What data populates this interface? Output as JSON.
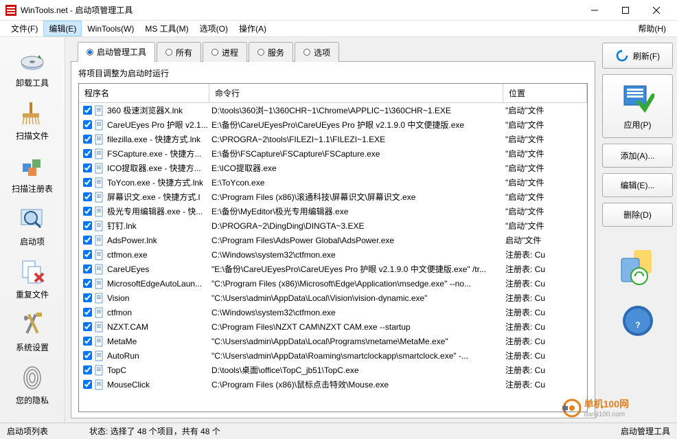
{
  "window": {
    "title": "WinTools.net - 启动项管理工具"
  },
  "menu": {
    "file": "文件(F)",
    "edit": "编辑(E)",
    "wintools": "WinTools(W)",
    "mstools": "MS 工具(M)",
    "options": "选项(O)",
    "actions": "操作(A)",
    "help": "帮助(H)"
  },
  "sidebar": [
    {
      "label": "卸载工具",
      "svg": "disk"
    },
    {
      "label": "扫描文件",
      "svg": "broom"
    },
    {
      "label": "扫描注册表",
      "svg": "blocks"
    },
    {
      "label": "启动项",
      "svg": "magnify"
    },
    {
      "label": "重复文件",
      "svg": "dup"
    },
    {
      "label": "系统设置",
      "svg": "tools"
    },
    {
      "label": "您的隐私",
      "svg": "finger"
    }
  ],
  "tabs": [
    {
      "label": "启动管理工具",
      "active": true
    },
    {
      "label": "所有"
    },
    {
      "label": "进程"
    },
    {
      "label": "服务"
    },
    {
      "label": "选项"
    }
  ],
  "subtitle": "将项目调整为启动时运行",
  "columns": {
    "name": "程序名",
    "cmd": "命令行",
    "loc": "位置"
  },
  "rows": [
    {
      "checked": true,
      "name": "360 极速浏览器X.lnk",
      "cmd": "D:\\tools\\360浏~1\\360CHR~1\\Chrome\\APPLIC~1\\360CHR~1.EXE",
      "loc": "\"启动\"文件"
    },
    {
      "checked": true,
      "name": "CareUEyes Pro 护眼 v2.1...",
      "cmd": "E:\\备份\\CareUEyesPro\\CareUEyes Pro 护眼 v2.1.9.0 中文便捷版.exe",
      "loc": "\"启动\"文件"
    },
    {
      "checked": true,
      "name": "filezilla.exe - 快捷方式.lnk",
      "cmd": "C:\\PROGRA~2\\tools\\FILEZI~1.1\\FILEZI~1.EXE",
      "loc": "\"启动\"文件"
    },
    {
      "checked": true,
      "name": "FSCapture.exe - 快捷方...",
      "cmd": "E:\\备份\\FSCapture\\FSCapture\\FSCapture.exe",
      "loc": "\"启动\"文件"
    },
    {
      "checked": true,
      "name": "ICO提取器.exe - 快捷方...",
      "cmd": "E:\\ICO提取器.exe",
      "loc": "\"启动\"文件"
    },
    {
      "checked": true,
      "name": "ToYcon.exe - 快捷方式.lnk",
      "cmd": "E:\\ToYcon.exe",
      "loc": "\"启动\"文件"
    },
    {
      "checked": true,
      "name": "屏幕识文.exe - 快捷方式.l",
      "cmd": "C:\\Program Files (x86)\\滚通科技\\屏幕识文\\屏幕识文.exe",
      "loc": "\"启动\"文件"
    },
    {
      "checked": true,
      "name": "极光专用编辑器.exe - 快...",
      "cmd": "E:\\备份\\MyEditor\\极光专用编辑器.exe",
      "loc": "\"启动\"文件"
    },
    {
      "checked": true,
      "name": "钉钉.lnk",
      "cmd": "D:\\PROGRA~2\\DingDing\\DINGTA~3.EXE",
      "loc": "\"启动\"文件"
    },
    {
      "checked": true,
      "name": "AdsPower.lnk",
      "cmd": "C:\\Program Files\\AdsPower Global\\AdsPower.exe",
      "loc": "启动\"文件"
    },
    {
      "checked": true,
      "name": "ctfmon.exe",
      "cmd": "C:\\Windows\\system32\\ctfmon.exe",
      "loc": "注册表: Cu"
    },
    {
      "checked": true,
      "name": "CareUEyes",
      "cmd": "\"E:\\备份\\CareUEyesPro\\CareUEyes Pro 护眼 v2.1.9.0 中文便捷版.exe\" /tr...",
      "loc": "注册表: Cu"
    },
    {
      "checked": true,
      "name": "MicrosoftEdgeAutoLaun...",
      "cmd": "\"C:\\Program Files (x86)\\Microsoft\\Edge\\Application\\msedge.exe\" --no...",
      "loc": "注册表: Cu"
    },
    {
      "checked": true,
      "name": "Vision",
      "cmd": "\"C:\\Users\\admin\\AppData\\Local\\Vision\\vision-dynamic.exe\"",
      "loc": "注册表: Cu"
    },
    {
      "checked": true,
      "name": "ctfmon",
      "cmd": "C:\\Windows\\system32\\ctfmon.exe",
      "loc": "注册表: Cu"
    },
    {
      "checked": true,
      "name": "NZXT.CAM",
      "cmd": "C:\\Program Files\\NZXT CAM\\NZXT CAM.exe --startup",
      "loc": "注册表: Cu"
    },
    {
      "checked": true,
      "name": "MetaMe",
      "cmd": "\"C:\\Users\\admin\\AppData\\Local\\Programs\\metame\\MetaMe.exe\"",
      "loc": "注册表: Cu"
    },
    {
      "checked": true,
      "name": "AutoRun",
      "cmd": "\"C:\\Users\\admin\\AppData\\Roaming\\smartclockapp\\smartclock.exe\" -...",
      "loc": "注册表: Cu"
    },
    {
      "checked": true,
      "name": "TopC",
      "cmd": "D:\\tools\\桌面\\office\\TopC_jb51\\TopC.exe",
      "loc": "注册表: Cu"
    },
    {
      "checked": true,
      "name": "MouseClick",
      "cmd": "C:\\Program Files (x86)\\鼠标点击特效\\Mouse.exe",
      "loc": "注册表: Cu"
    }
  ],
  "rightbar": {
    "refresh": "刷新(F)",
    "apply": "应用(P)",
    "add": "添加(A)...",
    "edit": "编辑(E)...",
    "delete": "删除(D)"
  },
  "statusbar": {
    "left": "启动项列表",
    "mid": "状态: 选择了 48 个项目，共有 48 个",
    "right": "启动管理工具"
  },
  "watermark": {
    "brand": "单机100网",
    "url": "danji100.com"
  }
}
